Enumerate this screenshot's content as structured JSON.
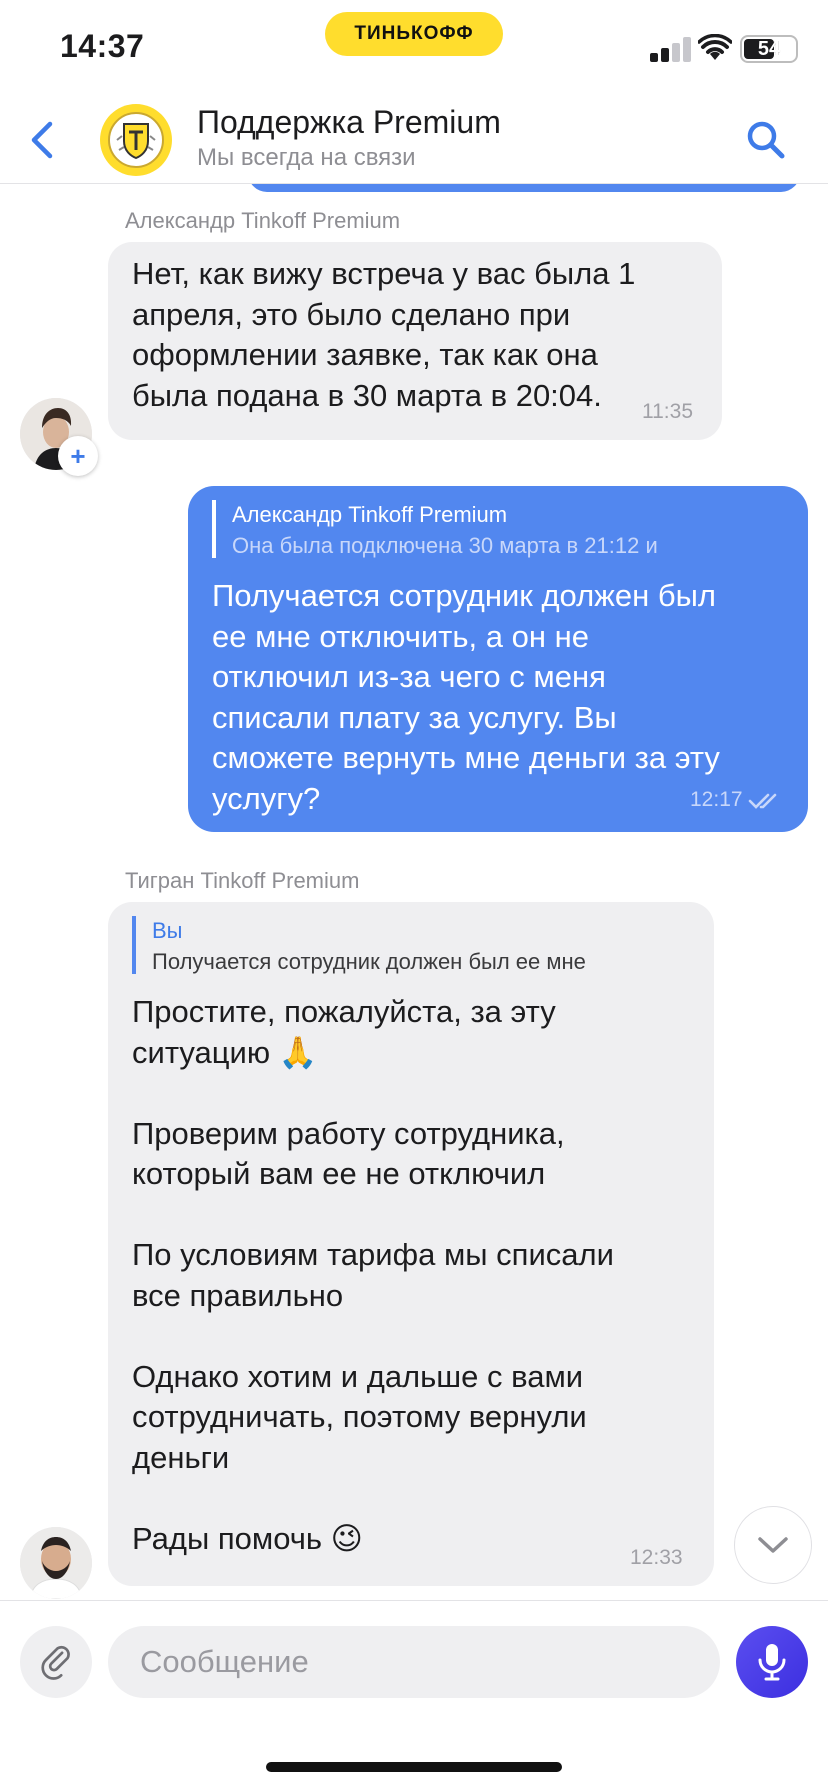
{
  "status_bar": {
    "time": "14:37",
    "brand": "ТИНЬКОФФ",
    "battery": "54"
  },
  "header": {
    "title": "Поддержка Premium",
    "subtitle": "Мы всегда на связи"
  },
  "messages": [
    {
      "sender": "Александр Tinkoff Premium",
      "text": "Нет, как вижу встреча у вас была 1\nапреля, это было сделано при\nоформлении заявке, так как она\nбыла подана в 30 марта в 20:04.",
      "time": "11:35"
    },
    {
      "reply_name": "Александр Tinkoff Premium",
      "reply_text": "Она была подключена 30 марта в 21:12 и",
      "text": "Получается сотрудник должен был\nее мне отключить, а он не\nотключил из-за чего с меня\nсписали плату за услугу. Вы\nсможете вернуть мне деньги за эту\nуслугу?",
      "time": "12:17"
    },
    {
      "sender": "Тигран Tinkoff Premium",
      "reply_name": "Вы",
      "reply_text": "Получается сотрудник должен был ее мне",
      "text": "Простите, пожалуйста, за эту\nситуацию 🙏\n\nПроверим работу сотрудника,\nкоторый вам ее не отключил\n\nПо условиям тарифа мы списали\nвсе правильно\n\nОднако хотим и дальше с вами\nсотрудничать, поэтому вернули\nденьги\n\nРады помочь 😉",
      "time": "12:33"
    }
  ],
  "composer": {
    "placeholder": "Сообщение"
  },
  "icons": {
    "back": "chevron-left-icon",
    "search": "search-icon",
    "attach": "paperclip-icon",
    "mic": "microphone-icon",
    "scroll": "chevron-down-icon"
  },
  "colors": {
    "accent": "#5287ef",
    "brand": "#ffdd2d",
    "incoming": "#efeff1",
    "mic": "#4a3de8"
  }
}
